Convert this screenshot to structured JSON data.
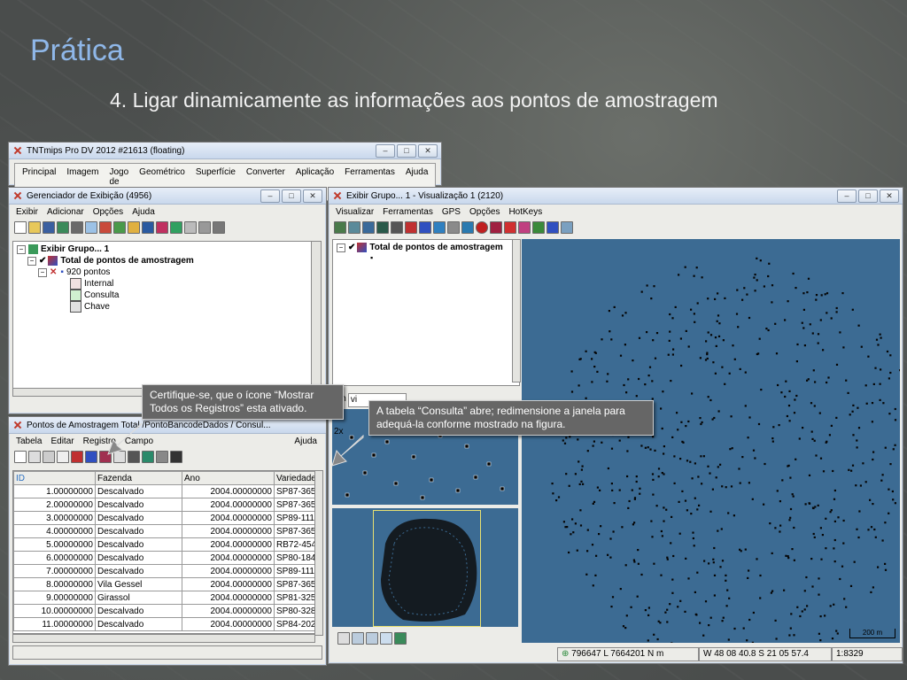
{
  "slide": {
    "title": "Prática",
    "subtitle": "4. Ligar dinamicamente as informações aos pontos de amostragem"
  },
  "main_window": {
    "title": "TNTmips Pro DV 2012  #21613 (floating)",
    "menu": [
      "Principal",
      "Imagem",
      "Jogo de Tiles",
      "Geométrico",
      "Superfície",
      "Converter",
      "Aplicação",
      "Ferramentas",
      "Ajuda"
    ]
  },
  "display_manager": {
    "title": "Gerenciador de Exibição (4956)",
    "menu": [
      "Exibir",
      "Adicionar",
      "Opções",
      "Ajuda"
    ],
    "tree": {
      "group": "Exibir Grupo... 1",
      "layer": "Total de pontos de amostragem",
      "points": "920 pontos",
      "tables": [
        "Internal",
        "Consulta",
        "Chave"
      ]
    }
  },
  "table_window": {
    "title": "Pontos de Amostragem Total /PontoBancodeDados / Consul...",
    "menu": [
      "Tabela",
      "Editar",
      "Registro",
      "Campo"
    ],
    "help": "Ajuda",
    "columns": [
      "ID",
      "Fazenda",
      "Ano",
      "Variedade"
    ],
    "rows": [
      [
        "1.00000000",
        "Descalvado",
        "2004.00000000",
        "SP87-365"
      ],
      [
        "2.00000000",
        "Descalvado",
        "2004.00000000",
        "SP87-365"
      ],
      [
        "3.00000000",
        "Descalvado",
        "2004.00000000",
        "SP89-111"
      ],
      [
        "4.00000000",
        "Descalvado",
        "2004.00000000",
        "SP87-365"
      ],
      [
        "5.00000000",
        "Descalvado",
        "2004.00000000",
        "RB72-454"
      ],
      [
        "6.00000000",
        "Descalvado",
        "2004.00000000",
        "SP80-184"
      ],
      [
        "7.00000000",
        "Descalvado",
        "2004.00000000",
        "SP89-111"
      ],
      [
        "8.00000000",
        "Vila Gessel",
        "2004.00000000",
        "SP87-365"
      ],
      [
        "9.00000000",
        "Girassol",
        "2004.00000000",
        "SP81-325"
      ],
      [
        "10.00000000",
        "Descalvado",
        "2004.00000000",
        "SP80-328"
      ],
      [
        "11.00000000",
        "Descalvado",
        "2004.00000000",
        "SP84-202"
      ]
    ]
  },
  "view_window": {
    "title": "Exibir Grupo... 1 - Visualização 1 (2120)",
    "menu": [
      "Visualizar",
      "Ferramentas",
      "GPS",
      "Opções",
      "HotKeys"
    ],
    "legend_layer": "Total de pontos de amostragem",
    "zoom_label": "om",
    "zoom_combo": "vi",
    "magnifier": "2x",
    "scale_bar": "200 m",
    "status": {
      "coords": "796647 L  7664201 N m",
      "latlon": "W 48 08 40.8  S 21 05 57.4",
      "scale": "1:8329"
    }
  },
  "callouts": {
    "left": "Certifique-se, que o ícone “Mostrar Todos os Registros” esta ativado.",
    "right": "A tabela “Consulta” abre; redimensione a janela para adequá-la conforme  mostrado na figura."
  },
  "colors": {
    "map_background": "#3c6b93",
    "slide_title": "#8fb7e8",
    "callout": "#666666"
  }
}
